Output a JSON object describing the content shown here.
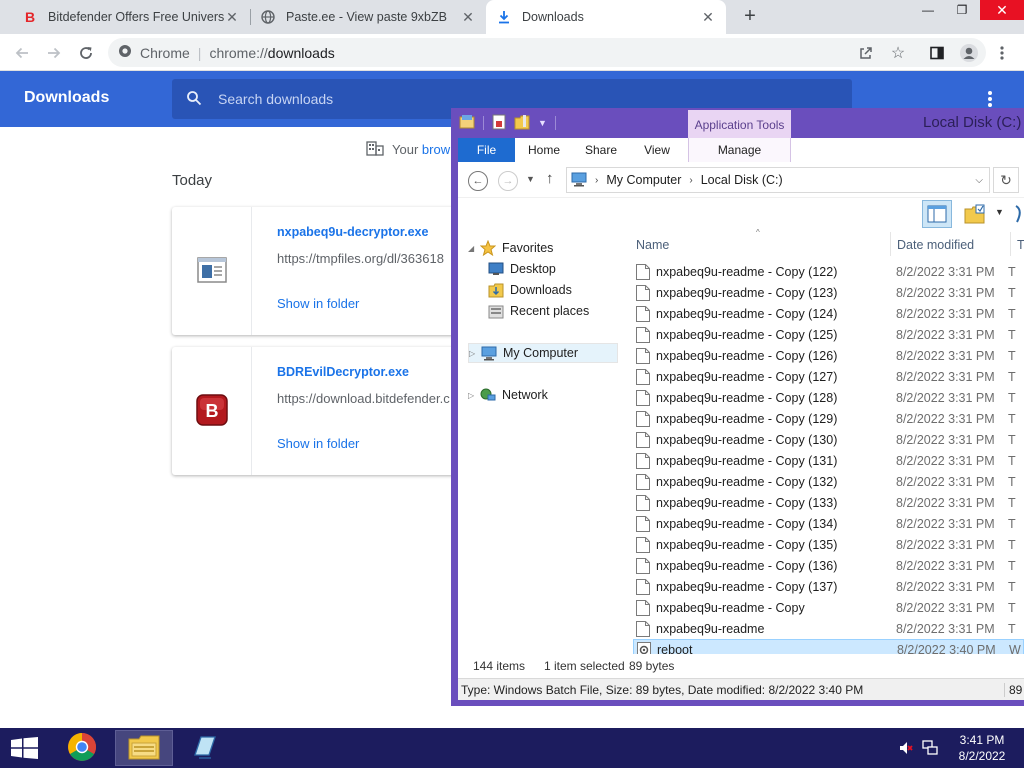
{
  "browser": {
    "tabs": [
      {
        "title": "Bitdefender Offers Free Universal",
        "active": false
      },
      {
        "title": "Paste.ee - View paste 9xbZB",
        "active": false
      },
      {
        "title": "Downloads",
        "active": true
      }
    ],
    "omnibox": {
      "brand": "Chrome",
      "url_scheme": "chrome://",
      "url_path": "downloads"
    }
  },
  "downloads": {
    "title": "Downloads",
    "search_placeholder": "Search downloads",
    "notice_prefix": "Your",
    "notice_link": "brow",
    "section_label": "Today",
    "items": [
      {
        "filename": "nxpabeq9u-decryptor.exe",
        "url": "https://tmpfiles.org/dl/363618",
        "action": "Show in folder"
      },
      {
        "filename": "BDREvilDecryptor.exe",
        "url": "https://download.bitdefender.c",
        "action": "Show in folder"
      }
    ]
  },
  "explorer": {
    "title": "Local Disk (C:)",
    "contextual_tab_group": "Application Tools",
    "ribbon_tabs": [
      "File",
      "Home",
      "Share",
      "View",
      "Manage"
    ],
    "breadcrumb": [
      "My Computer",
      "Local Disk (C:)"
    ],
    "nav": {
      "favorites": "Favorites",
      "favorites_items": [
        "Desktop",
        "Downloads",
        "Recent places"
      ],
      "computer": "My Computer",
      "network": "Network"
    },
    "columns": {
      "name": "Name",
      "date": "Date modified",
      "type": "T"
    },
    "files": [
      {
        "name": "nxpabeq9u-readme - Copy (122)",
        "date": "8/2/2022 3:31 PM",
        "type": "T"
      },
      {
        "name": "nxpabeq9u-readme - Copy (123)",
        "date": "8/2/2022 3:31 PM",
        "type": "T"
      },
      {
        "name": "nxpabeq9u-readme - Copy (124)",
        "date": "8/2/2022 3:31 PM",
        "type": "T"
      },
      {
        "name": "nxpabeq9u-readme - Copy (125)",
        "date": "8/2/2022 3:31 PM",
        "type": "T"
      },
      {
        "name": "nxpabeq9u-readme - Copy (126)",
        "date": "8/2/2022 3:31 PM",
        "type": "T"
      },
      {
        "name": "nxpabeq9u-readme - Copy (127)",
        "date": "8/2/2022 3:31 PM",
        "type": "T"
      },
      {
        "name": "nxpabeq9u-readme - Copy (128)",
        "date": "8/2/2022 3:31 PM",
        "type": "T"
      },
      {
        "name": "nxpabeq9u-readme - Copy (129)",
        "date": "8/2/2022 3:31 PM",
        "type": "T"
      },
      {
        "name": "nxpabeq9u-readme - Copy (130)",
        "date": "8/2/2022 3:31 PM",
        "type": "T"
      },
      {
        "name": "nxpabeq9u-readme - Copy (131)",
        "date": "8/2/2022 3:31 PM",
        "type": "T"
      },
      {
        "name": "nxpabeq9u-readme - Copy (132)",
        "date": "8/2/2022 3:31 PM",
        "type": "T"
      },
      {
        "name": "nxpabeq9u-readme - Copy (133)",
        "date": "8/2/2022 3:31 PM",
        "type": "T"
      },
      {
        "name": "nxpabeq9u-readme - Copy (134)",
        "date": "8/2/2022 3:31 PM",
        "type": "T"
      },
      {
        "name": "nxpabeq9u-readme - Copy (135)",
        "date": "8/2/2022 3:31 PM",
        "type": "T"
      },
      {
        "name": "nxpabeq9u-readme - Copy (136)",
        "date": "8/2/2022 3:31 PM",
        "type": "T"
      },
      {
        "name": "nxpabeq9u-readme - Copy (137)",
        "date": "8/2/2022 3:31 PM",
        "type": "T"
      },
      {
        "name": "nxpabeq9u-readme - Copy",
        "date": "8/2/2022 3:31 PM",
        "type": "T"
      },
      {
        "name": "nxpabeq9u-readme",
        "date": "8/2/2022 3:31 PM",
        "type": "T"
      },
      {
        "name": "reboot",
        "date": "8/2/2022 3:40 PM",
        "type": "W",
        "selected": true
      }
    ],
    "status": {
      "count": "144 items",
      "selection": "1 item selected",
      "size": "89 bytes"
    },
    "details": {
      "text": "Type: Windows Batch File, Size: 89 bytes, Date modified: 8/2/2022 3:40 PM",
      "right": "89"
    }
  },
  "taskbar": {
    "time": "3:41 PM",
    "date": "8/2/2022"
  }
}
